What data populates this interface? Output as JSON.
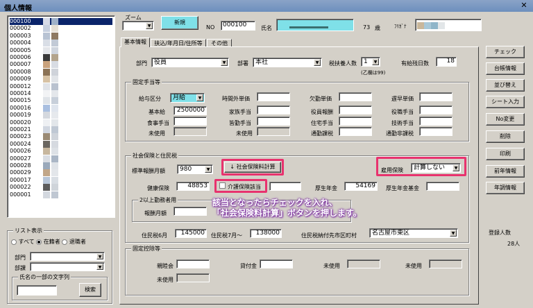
{
  "window": {
    "title": "個人情報",
    "close": "✕"
  },
  "employee_list": {
    "ids": [
      "000100",
      "000002",
      "000003",
      "000004",
      "000005",
      "000006",
      "000007",
      "000008",
      "000009",
      "000012",
      "000014",
      "000015",
      "000016",
      "000019",
      "000020",
      "000021",
      "000023",
      "000024",
      "000026",
      "000027",
      "000028",
      "000029",
      "000017",
      "000022",
      "000001"
    ],
    "selected": "000100"
  },
  "header": {
    "zoom_label": "ズーム",
    "new_button": "新規",
    "no_label": "NO",
    "no_value": "000100",
    "name_label": "氏名",
    "age_value": "73",
    "age_unit": "歳",
    "kana_label": "ﾌﾘｶﾞﾅ"
  },
  "tabs": [
    "基本情報",
    "扶込/年月日/住所等",
    "その他"
  ],
  "basic": {
    "dept_label": "部門",
    "dept_value": "役員",
    "division_label": "部署",
    "division_value": "本社",
    "dependents_label": "税扶養人数",
    "dependents_value": "1",
    "dependents_note": "(乙欄は99)",
    "paid_leave_label": "有給残日数",
    "paid_leave_value": "18"
  },
  "allowance": {
    "group_label": "固定手当等",
    "pay_type_label": "給与区分",
    "pay_type_value": "月給",
    "base_label": "基本給",
    "base_value": "2500000",
    "meal_label": "食事手当",
    "unused_label": "未使用",
    "overtime_label": "時間外単価",
    "family_label": "家族手当",
    "commute_label": "皆勤手当",
    "unused2_label": "未使用",
    "absence_label": "欠勤単価",
    "officer_label": "役員報酬",
    "housing_label": "住宅手当",
    "commute_tax_label": "通勤課税",
    "late_label": "遅早単価",
    "position_label": "役職手当",
    "skill_label": "技術手当",
    "commute_nontax_label": "通勤非課税"
  },
  "insurance": {
    "group_label": "社会保険と住民税",
    "std_monthly_label": "標準報酬月額",
    "std_monthly_value": "980",
    "calc_button": "↓ 社会保険料計算",
    "employment_label": "雇用保険",
    "employment_value": "計算しない",
    "health_label": "健康保険",
    "health_value": "48853",
    "care_label": "介護保険該当",
    "pension_label": "厚生年金",
    "pension_value": "54169",
    "pension_fund_label": "厚生年金基金",
    "multi_group_label": "2以上勤務者用",
    "monthly_label": "報酬月額",
    "resident_tax_label": "住民税6月",
    "resident_tax_value": "145000",
    "resident_tax7_label": "住民税7月〜",
    "resident_tax7_value": "138000",
    "resident_city_label": "住民税納付先市区町村",
    "resident_city_value": "名古屋市東区"
  },
  "deduction": {
    "group_label": "固定控除等",
    "savings_label": "親睦会",
    "loan_label": "貸付金",
    "unused_a": "未使用",
    "unused_b": "未使用",
    "unused_c": "未使用"
  },
  "annotation": {
    "line1": "該当となったらチェックを入れ、",
    "line2": "「社会保険料計算」ボタンを押します。"
  },
  "side_buttons": [
    "チェック",
    "台帳情報",
    "並び替え",
    "シート入力",
    "No変更",
    "削除",
    "印刷",
    "前年情報",
    "年調情報"
  ],
  "registered": {
    "label": "登録人数",
    "value": "28人"
  },
  "filter": {
    "group_label": "リスト表示",
    "opt_all": "すべて",
    "opt_active": "在籍者",
    "opt_retired": "退職者",
    "dept_label": "部門",
    "division_label": "部課",
    "name_search_label": "氏名の一部の文字列",
    "search_button": "検索"
  },
  "colors": {
    "accent_pink": "#e8326e",
    "selection": "#0a246a",
    "new_button": "#7fe0e8"
  }
}
